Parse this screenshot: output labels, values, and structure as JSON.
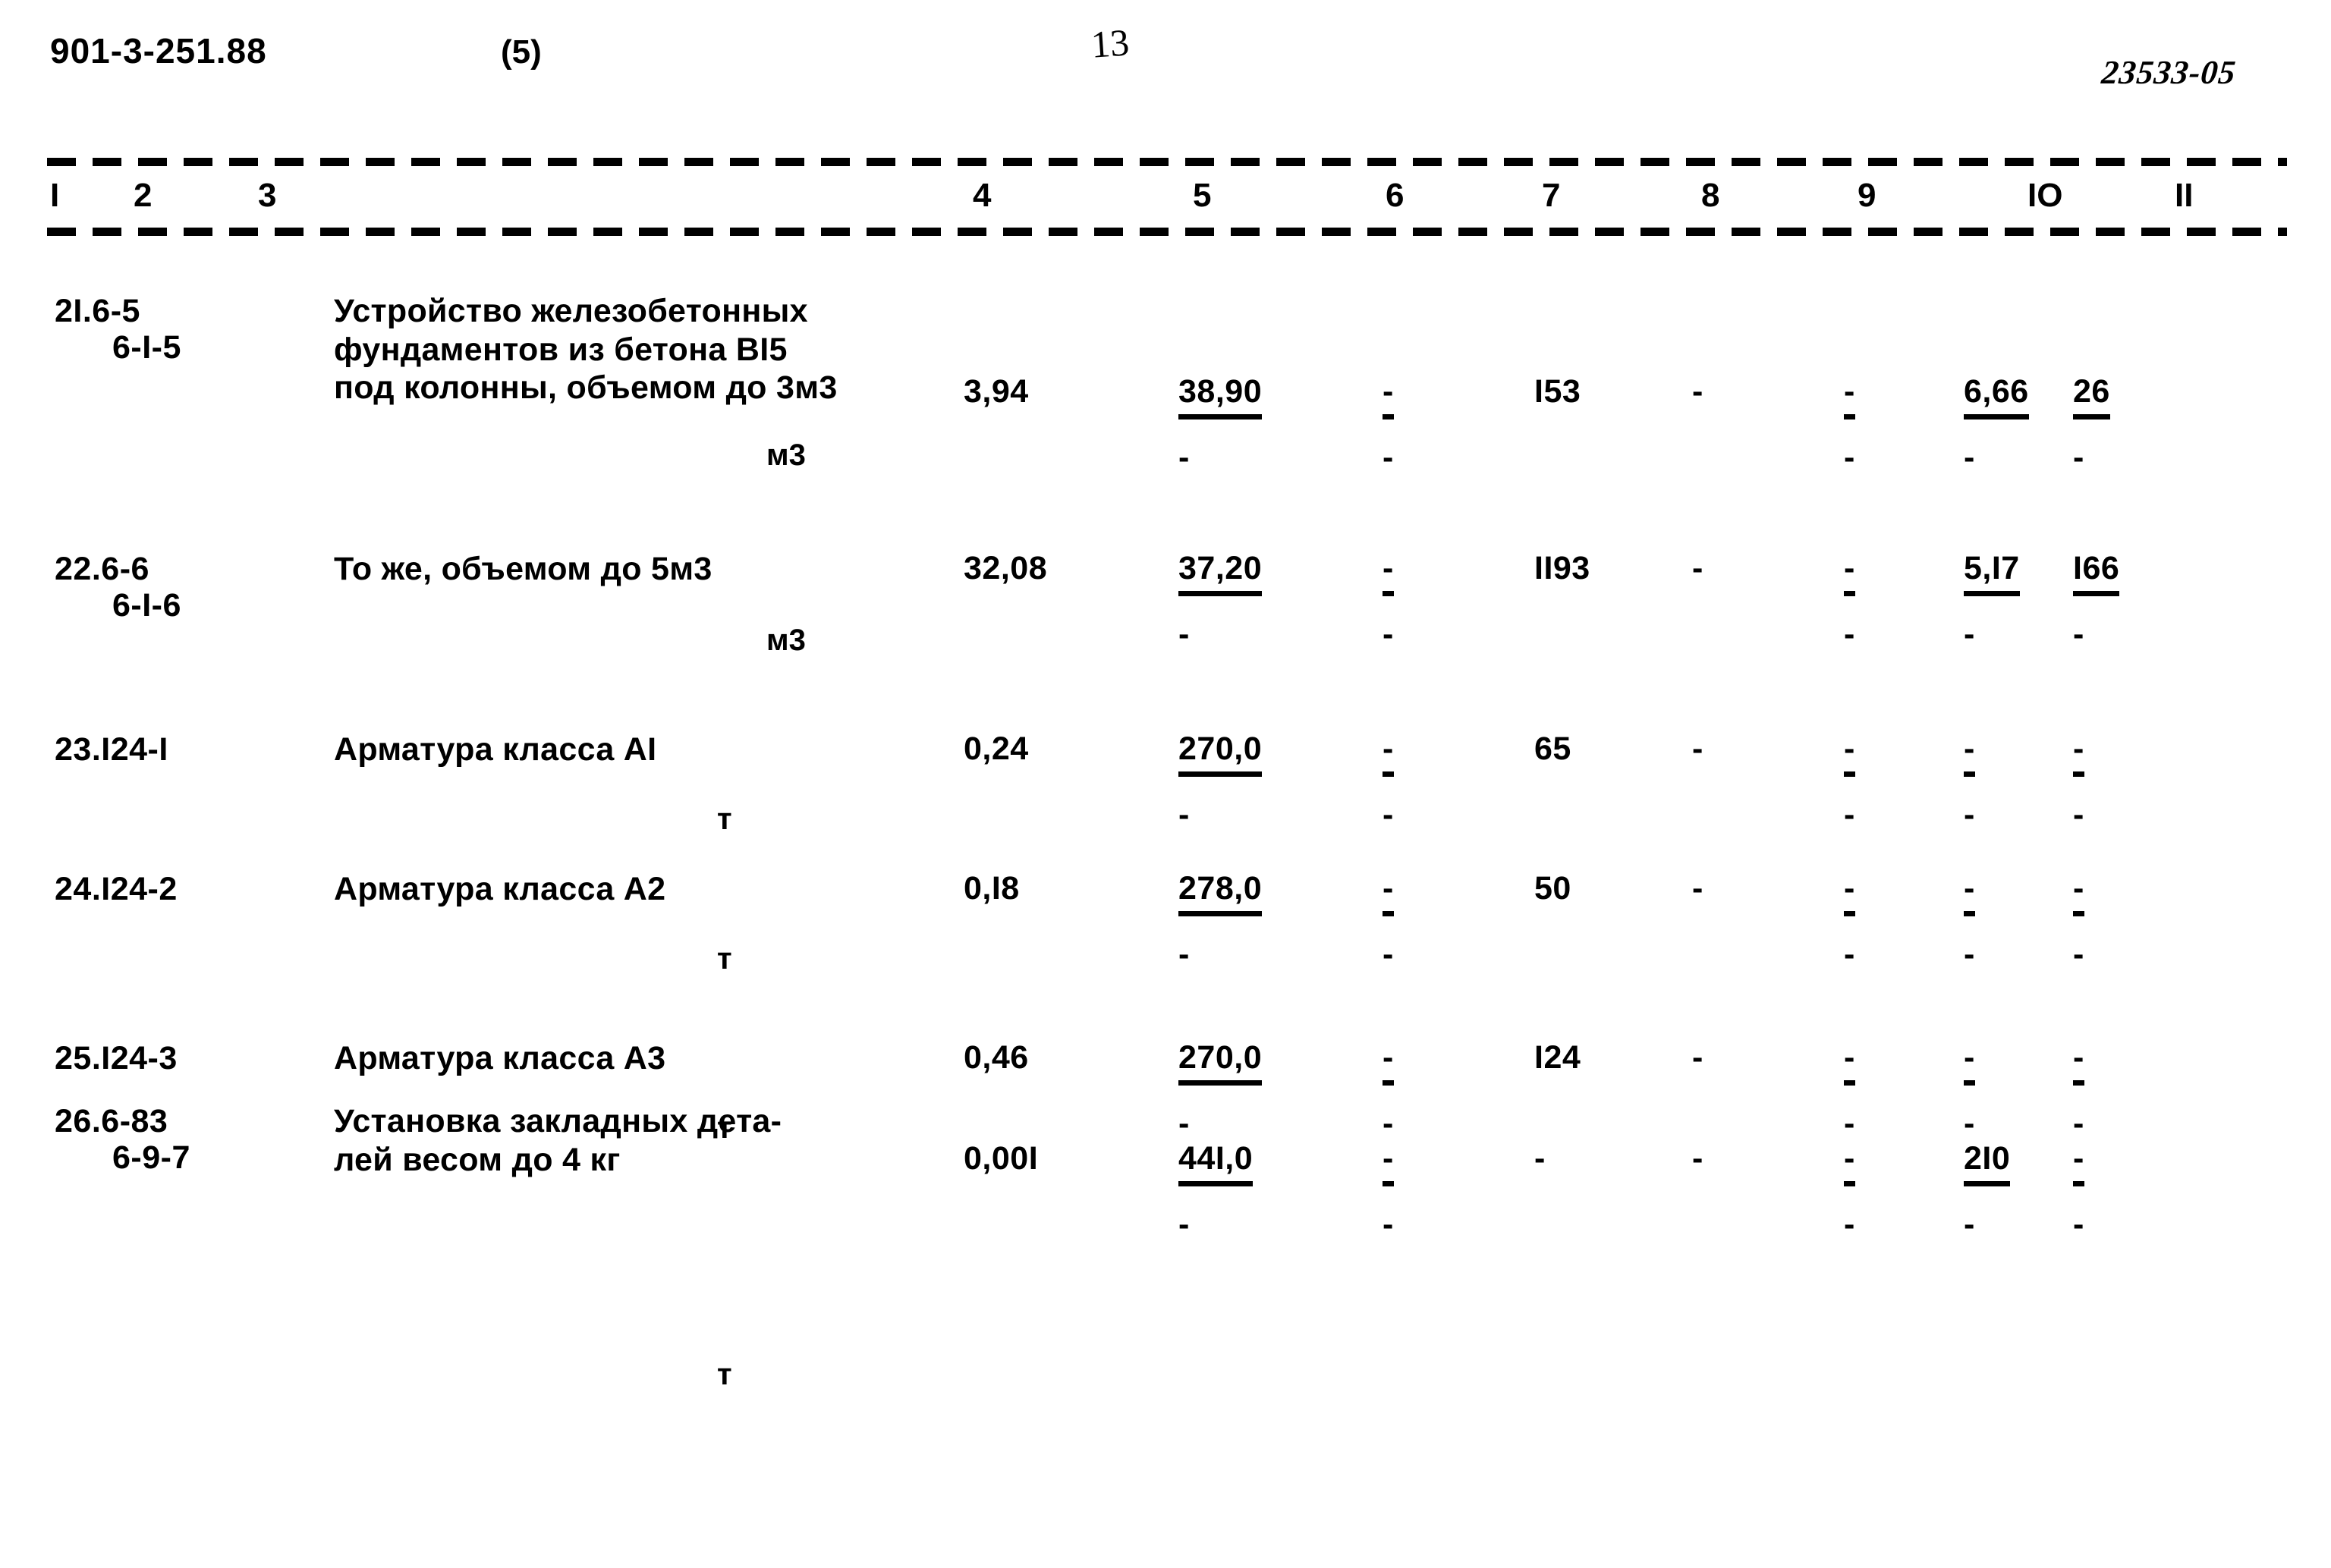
{
  "header": {
    "doc_code": "901-3-251.88",
    "sheet_marker": "(5)",
    "page_number": "13",
    "archive_code": "23533-05"
  },
  "table": {
    "column_headers": [
      "I",
      "2",
      "3",
      "4",
      "5",
      "6",
      "7",
      "8",
      "9",
      "IO",
      "II"
    ],
    "rows": [
      {
        "code_main": "2I.6-5",
        "code_sub": "6-I-5",
        "description": "Устройство железобетонных\nфундаментов из бетона BI5\nпод колонны, объемом до 3м3",
        "unit": "м3",
        "c4": "3,94",
        "c5": "38,90",
        "c5_sub": "-",
        "c6": "-",
        "c6_sub": "-",
        "c7": "I53",
        "c7_sub": "",
        "c8": "-",
        "c8_sub": "",
        "c9": "-",
        "c9_sub": "-",
        "c10": "6,66",
        "c10_sub": "-",
        "c11": "26",
        "c11_sub": "-"
      },
      {
        "code_main": "22.6-6",
        "code_sub": "6-I-6",
        "description": "То же, объемом до 5м3",
        "unit": "м3",
        "c4": "32,08",
        "c5": "37,20",
        "c5_sub": "-",
        "c6": "-",
        "c6_sub": "-",
        "c7": "II93",
        "c7_sub": "",
        "c8": "-",
        "c8_sub": "",
        "c9": "-",
        "c9_sub": "-",
        "c10": "5,I7",
        "c10_sub": "-",
        "c11": "I66",
        "c11_sub": "-"
      },
      {
        "code_main": "23.I24-I",
        "code_sub": "",
        "description": "Арматура класса АI",
        "unit": "т",
        "c4": "0,24",
        "c5": "270,0",
        "c5_sub": "-",
        "c6": "-",
        "c6_sub": "-",
        "c7": "65",
        "c7_sub": "",
        "c8": "-",
        "c8_sub": "",
        "c9": "-",
        "c9_sub": "-",
        "c10": "-",
        "c10_sub": "-",
        "c11": "-",
        "c11_sub": "-"
      },
      {
        "code_main": "24.I24-2",
        "code_sub": "",
        "description": "Арматура класса А2",
        "unit": "т",
        "c4": "0,I8",
        "c5": "278,0",
        "c5_sub": "-",
        "c6": "-",
        "c6_sub": "-",
        "c7": "50",
        "c7_sub": "",
        "c8": "-",
        "c8_sub": "",
        "c9": "-",
        "c9_sub": "-",
        "c10": "-",
        "c10_sub": "-",
        "c11": "-",
        "c11_sub": "-"
      },
      {
        "code_main": "25.I24-3",
        "code_sub": "",
        "description": "Арматура класса А3",
        "unit": "т",
        "c4": "0,46",
        "c5": "270,0",
        "c5_sub": "-",
        "c6": "-",
        "c6_sub": "-",
        "c7": "I24",
        "c7_sub": "",
        "c8": "-",
        "c8_sub": "",
        "c9": "-",
        "c9_sub": "-",
        "c10": "-",
        "c10_sub": "-",
        "c11": "-",
        "c11_sub": "-"
      },
      {
        "code_main": "26.6-83",
        "code_sub": "6-9-7",
        "description": "Установка закладных дета-\nлей весом до 4 кг",
        "unit": "т",
        "c4": "0,00I",
        "c5": "44I,0",
        "c5_sub": "-",
        "c6": "-",
        "c6_sub": "-",
        "c7": "-",
        "c7_sub": "",
        "c8": "-",
        "c8_sub": "",
        "c9": "-",
        "c9_sub": "-",
        "c10": "2I0",
        "c10_sub": "-",
        "c11": "-",
        "c11_sub": "-"
      }
    ]
  }
}
